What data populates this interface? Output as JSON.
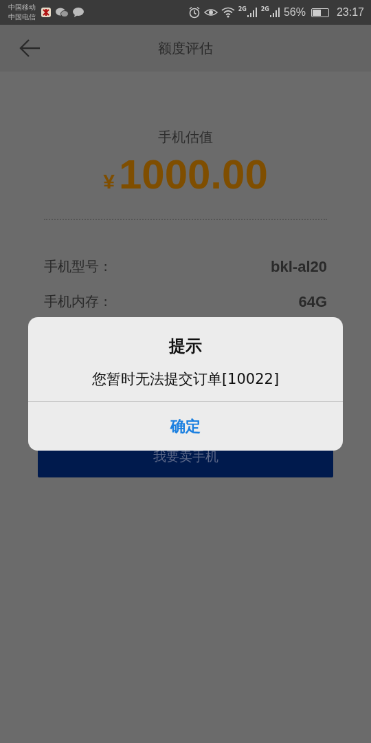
{
  "status_bar": {
    "carriers": [
      "中国移动",
      "中国电信"
    ],
    "network_labels": [
      "2G",
      "2G"
    ],
    "battery_text": "56%",
    "time": "23:17"
  },
  "header": {
    "title": "额度评估"
  },
  "valuation": {
    "label": "手机估值",
    "currency": "¥",
    "amount": "1000.00"
  },
  "specs": [
    {
      "label": "手机型号 :",
      "value": "bkl-al20"
    },
    {
      "label": "手机内存 :",
      "value": "64G"
    }
  ],
  "sell_button": {
    "label": "我要卖手机"
  },
  "dialog": {
    "title": "提示",
    "message": "您暂时无法提交订单[10022]",
    "confirm": "确定"
  }
}
